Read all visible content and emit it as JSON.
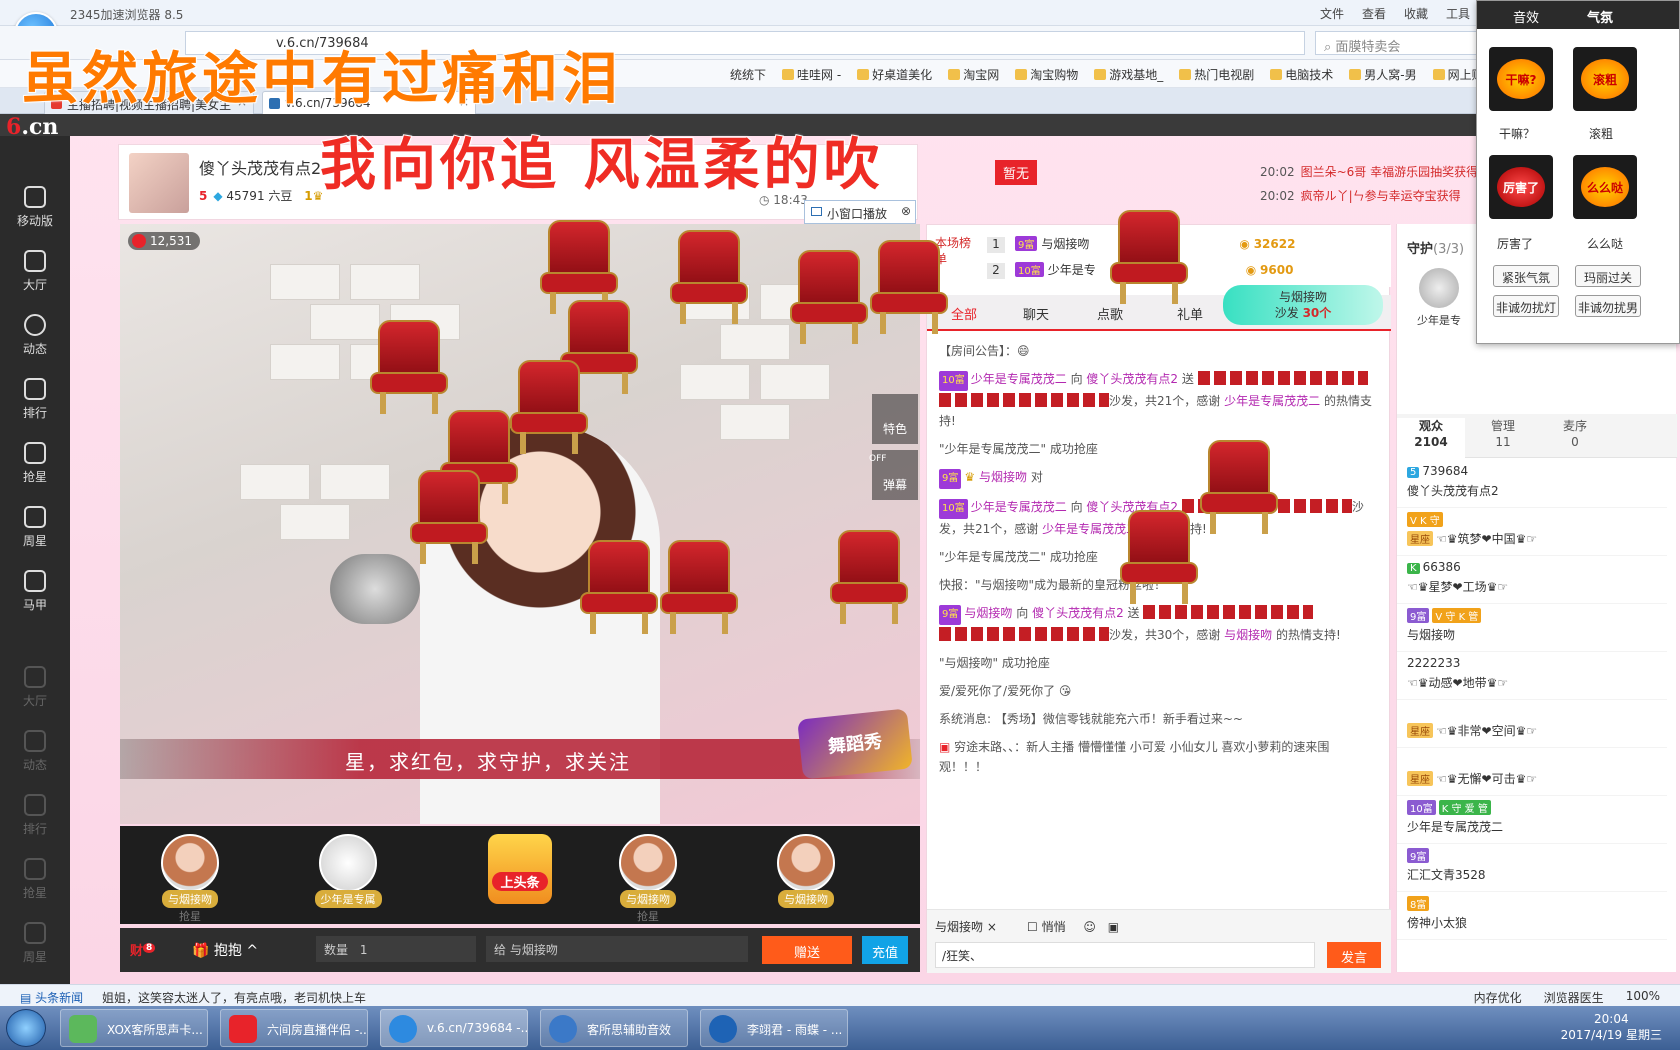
{
  "browser": {
    "title": "2345加速浏览器 8.5",
    "menu": [
      "文件",
      "查看",
      "收藏",
      "工具"
    ],
    "url": "v.6.cn/739684",
    "search_placeholder": "面膜特卖会",
    "bookmarks": [
      "统统下",
      "哇哇网 -",
      "好桌道美化",
      "淘宝网",
      "淘宝购物",
      "游戏基地_",
      "热门电视剧",
      "电脑技术",
      "男人窝-男",
      "网上购物"
    ],
    "tabs": [
      {
        "label": "主播招聘|视频主播招聘|美女主"
      },
      {
        "label": "v.6.cn/739684"
      }
    ]
  },
  "site": {
    "logo": "6.cn",
    "sidebar": [
      {
        "label": "移动版"
      },
      {
        "label": "大厅"
      },
      {
        "label": "动态"
      },
      {
        "label": "排行"
      },
      {
        "label": "抢星"
      },
      {
        "label": "周星"
      },
      {
        "label": "马甲"
      }
    ],
    "sidebar_faded": [
      "大厅",
      "动态",
      "排行",
      "抢星",
      "周星"
    ]
  },
  "anchor": {
    "name": "傻丫头茂茂有点2",
    "level": "5",
    "beans": "45791 六豆",
    "rank": "1",
    "time": "18:43",
    "mini_window": "小窗口播放",
    "status": "暂无"
  },
  "tickers": [
    {
      "time": "20:02",
      "text": "图兰朵~6哥 幸福游乐园抽奖获得"
    },
    {
      "time": "20:02",
      "text": "疯帝ル丫|ㄣ参与幸运夺宝获得"
    }
  ],
  "video": {
    "viewers": "12,531",
    "caption": "星，求红包，求守护，求关注",
    "tool_color": "特色",
    "tool_barrage": "弹幕",
    "barrage_state": "OFF",
    "dance_logo": "舞蹈秀"
  },
  "seats": [
    {
      "label": "与烟接吻",
      "sub": "抢星"
    },
    {
      "label": "少年是专属",
      "sub": ""
    },
    {
      "label": "上头条",
      "sub": "抢星"
    },
    {
      "label": "与烟接吻",
      "sub": "抢星"
    },
    {
      "label": "与烟接吻",
      "sub": ""
    }
  ],
  "gift_bar": {
    "cai": "财",
    "cai_count": "8",
    "hug": "抱抱",
    "qty_label": "数量",
    "qty_value": "1",
    "to_label": "给",
    "to_value": "与烟接吻",
    "send": "赠送",
    "recharge": "充值"
  },
  "rank": {
    "tag": "本场榜单",
    "rows": [
      {
        "n": "1",
        "badge": "9富",
        "name": "与烟接吻",
        "score": "32622"
      },
      {
        "n": "2",
        "badge": "10富",
        "name": "少年是专",
        "score": "9600"
      }
    ]
  },
  "gift_banner": {
    "name": "与烟接吻",
    "text": "沙发",
    "count": "30个"
  },
  "chat_tabs": [
    "全部",
    "聊天",
    "点歌",
    "礼单"
  ],
  "chat": {
    "notice_label": "【房间公告】：",
    "m1_user": "少年是专属茂茂二",
    "m1_to": "向",
    "m1_target": "傻丫头茂茂有点2",
    "m1_send": "送",
    "m1_tail": "沙发，共21个，感谢",
    "m1_thanks": "少年是专属茂茂二",
    "m1_end": "的热情支持!",
    "m2": "\"少年是专属茂茂二\" 成功抢座",
    "m3_user": "与烟接吻",
    "m3_to": "对",
    "m4_user": "少年是专属茂茂二",
    "m4_to": "向",
    "m4_target": "傻丫头茂茂有点2",
    "m4_tail": "沙发，共21个，感谢",
    "m4_thanks": "少年是专属茂茂二",
    "m4_end": "的热情支持!",
    "m5": "\"少年是专属茂茂二\" 成功抢座",
    "m6": "快报：\"与烟接吻\"成为最新的皇冠粉丝啦！",
    "m7_user": "与烟接吻",
    "m7_to": "向",
    "m7_target": "傻丫头茂茂有点2",
    "m7_send": "送",
    "m7_tail": "沙发，共30个，感谢",
    "m7_thanks": "与烟接吻",
    "m7_end": "的热情支持!",
    "m8": "\"与烟接吻\" 成功抢座",
    "m9": "爱/爱死你了/爱死你了",
    "m10": "系统消息: 【秀场】微信零钱就能充六币！新手看过来~~",
    "m11": "穷途末路、、：新人主播 懵懵懂懂 小可爱 小仙女儿 喜欢小萝莉的速来围观！！！"
  },
  "chat_input": {
    "target": "与烟接吻",
    "whisper": "悄悄",
    "value": "/狂笑、",
    "send": "发言"
  },
  "right": {
    "guard_title": "守护",
    "guard_count": "(3/3)",
    "guard_name": "少年是专",
    "aud_tabs": [
      {
        "label": "观众",
        "count": "2104"
      },
      {
        "label": "管理",
        "count": "11"
      },
      {
        "label": "麦序",
        "count": "0"
      }
    ],
    "audience": [
      {
        "tags": "5",
        "name": "739684",
        "sub": "傻丫头茂茂有点2"
      },
      {
        "tags": "V K 守",
        "name": "☜♛筑梦❤中国♛☞",
        "sub": "星座"
      },
      {
        "tags": "K",
        "name": "66386",
        "sub": "☜♛星梦❤工场♛☞"
      },
      {
        "tags": "V 守 K 管",
        "name": "与烟接吻",
        "sub": "9富"
      },
      {
        "tags": "",
        "name": "2222233",
        "sub": "☜♛动感❤地带♛☞"
      },
      {
        "tags": "",
        "name": "☜♛非常❤空间♛☞",
        "sub": "星座"
      },
      {
        "tags": "",
        "name": "☜♛无懈❤可击♛☞",
        "sub": "星座"
      },
      {
        "tags": "K 守 爱 管",
        "name": "少年是专属茂茂二",
        "sub": "10富"
      },
      {
        "tags": "",
        "name": "汇汇文青3528",
        "sub": "9富"
      },
      {
        "tags": "",
        "name": "傍神小太狼",
        "sub": "8富"
      }
    ]
  },
  "emoji_popup": {
    "tabs": [
      "音效",
      "气氛"
    ],
    "items": [
      {
        "icon": "干嘛?",
        "label": "干嘛？"
      },
      {
        "icon": "滚粗",
        "label": "滚粗"
      },
      {
        "icon": "厉害了",
        "label": "厉害了"
      },
      {
        "icon": "么么哒",
        "label": "么么哒"
      }
    ],
    "quick": [
      "紧张气氛",
      "玛丽过关",
      "非诚勿扰灯",
      "非诚勿扰男"
    ]
  },
  "lyrics": {
    "line1": "虽然旅途中有过痛和泪",
    "line2": "我向你追  风温柔的吹"
  },
  "statusbar": {
    "news": "头条新闻",
    "message": "姐姐，这笑容太迷人了，有亮点哦，老司机快上车",
    "right": [
      "内存优化",
      "浏览器医生",
      "100%"
    ]
  },
  "taskbar": {
    "items": [
      "XOX客所思声卡...",
      "六间房直播伴侣 -...",
      "v.6.cn/739684 -...",
      "客所思辅助音效",
      "李翊君 - 雨蝶 - ..."
    ],
    "time": "20:04",
    "date": "2017/4/19 星期三"
  },
  "colors": {
    "accent": "#e8232a",
    "send": "#ff5b1a",
    "recharge": "#11a3e6"
  }
}
